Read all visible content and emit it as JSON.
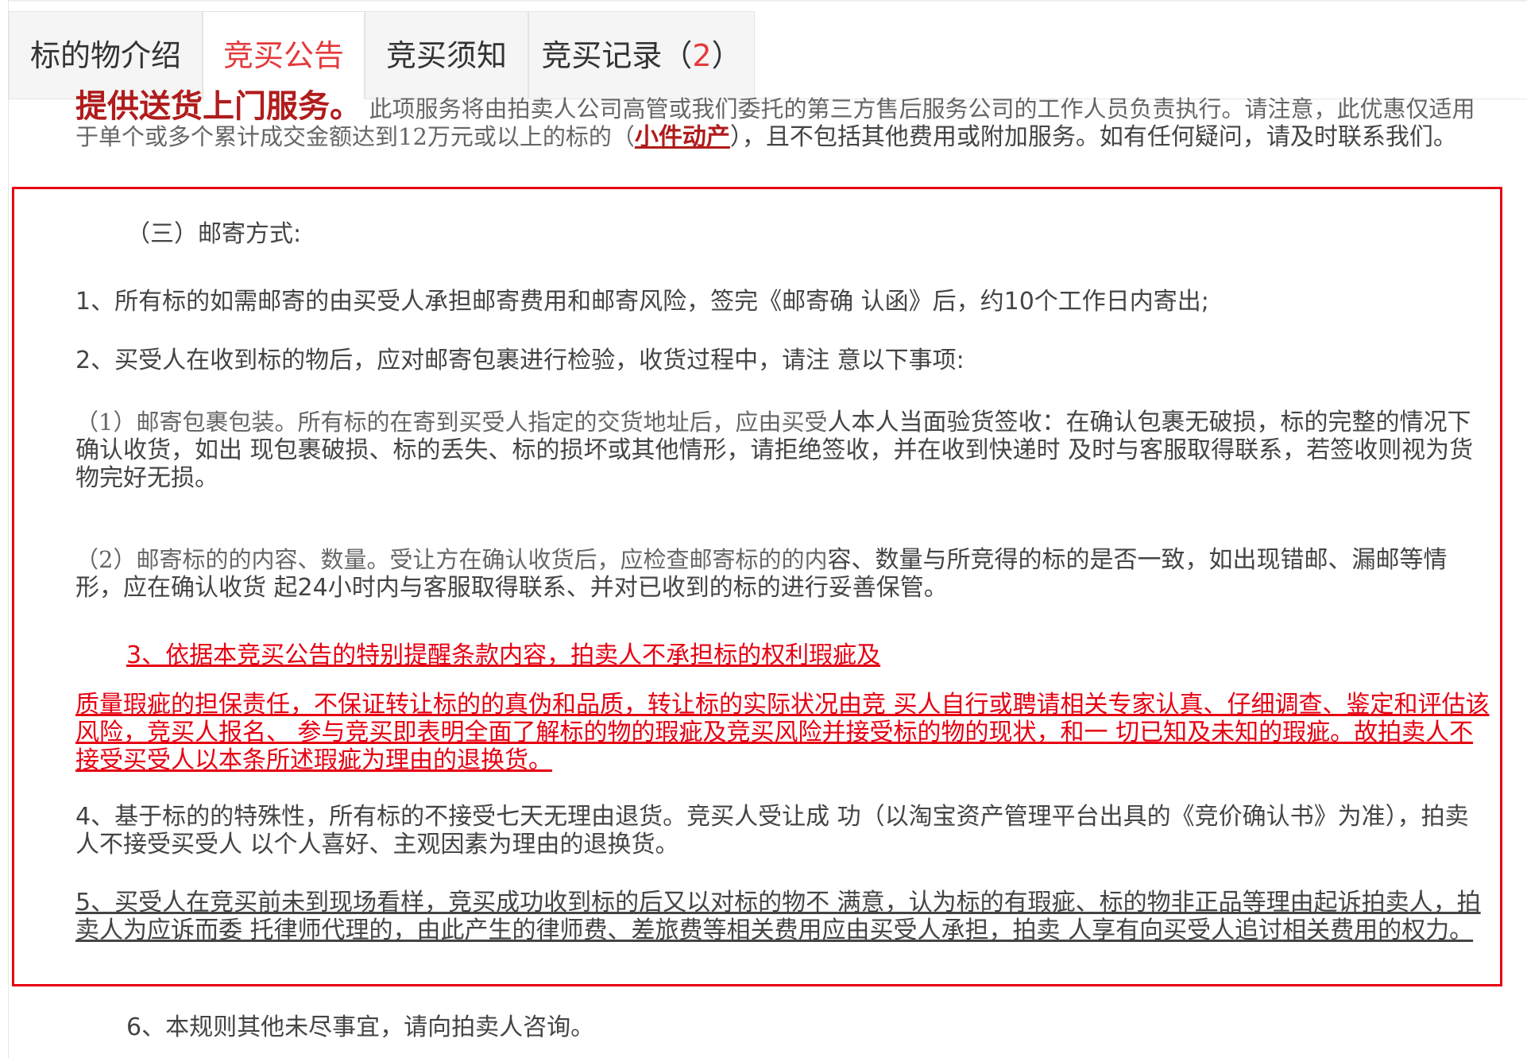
{
  "tabs": [
    {
      "label": "标的物介绍",
      "active": false
    },
    {
      "label": "竞买公告",
      "active": true
    },
    {
      "label": "竞买须知",
      "active": false
    },
    {
      "label": "竞买记录（",
      "count": "2",
      "suffix": "）",
      "active": false
    }
  ],
  "intro": {
    "headline": "提供送货上门服务。",
    "text_1": "此项服务将由拍卖人公司高管或我们委托的第三方售后服务公司的工作人员负责执行。请注意，此优惠仅适用于单个或多个累计成交金额达到12万元或以上的标的（",
    "link": "小件动产",
    "text_2": "），且不包括其他费用或附加服务。如有任何疑问，请及时联系我们。"
  },
  "section": {
    "heading": "（三）邮寄方式:",
    "item1": "1、所有标的如需邮寄的由买受人承担邮寄费用和邮寄风险，签完《邮寄确 认函》后，约10个工作日内寄出;",
    "item2": "2、买受人在收到标的物后，应对邮寄包裹进行检验，收货过程中，请注 意以下事项:",
    "sub1_serif": "（1）邮寄包裹包装。所有标的在寄到买受人指定的交货地址后，应由买受",
    "sub1_rest": "人本人当面验货签收：在确认包裹无破损，标的完整的情况下确认收货，如出 现包裹破损、标的丢失、标的损坏或其他情形，请拒绝签收，并在收到快递时 及时与客服取得联系，若签收则视为货物完好无损。",
    "sub2_serif": "（2）邮寄标的的内容、数量。受让方在确认收货后，应检查邮寄标的的内",
    "sub2_rest": "容、数量与所竞得的标的是否一致，如出现错邮、漏邮等情形，应在确认收货 起24小时内与客服取得联系、并对已收到的标的进行妥善保管。",
    "item3_line1": "3、依据本竞买公告的特别提醒条款内容，拍卖人不承担标的权利瑕疵及",
    "item3_rest": "质量瑕疵的担保责任，不保证转让标的的真伪和品质，转让标的实际状况由竞 买人自行或聘请相关专家认真、仔细调查、鉴定和评估该风险，竞买人报名、 参与竞买即表明全面了解标的物的瑕疵及竞买风险并接受标的物的现状，和一 切已知及未知的瑕疵。故拍卖人不接受买受人以本条所述瑕疵为理由的退换货。",
    "item4": "4、基于标的的特殊性，所有标的不接受七天无理由退货。竞买人受让成 功（以淘宝资产管理平台出具的《竞价确认书》为准），拍卖人不接受买受人 以个人喜好、主观因素为理由的退换货。",
    "item5": "5、买受人在竞买前未到现场看样，竞买成功收到标的后又以对标的物不 满意，认为标的有瑕疵、标的物非正品等理由起诉拍卖人，拍卖人为应诉而委 托律师代理的，由此产生的律师费、差旅费等相关费用应由买受人承担，拍卖 人享有向买受人追讨相关费用的权力。",
    "item6": "6、本规则其他未尽事宜，请向拍卖人咨询。"
  },
  "colors": {
    "accent_red": "#e4393c",
    "highlight_box": "#e60012",
    "headline_red": "#b01c1c"
  }
}
